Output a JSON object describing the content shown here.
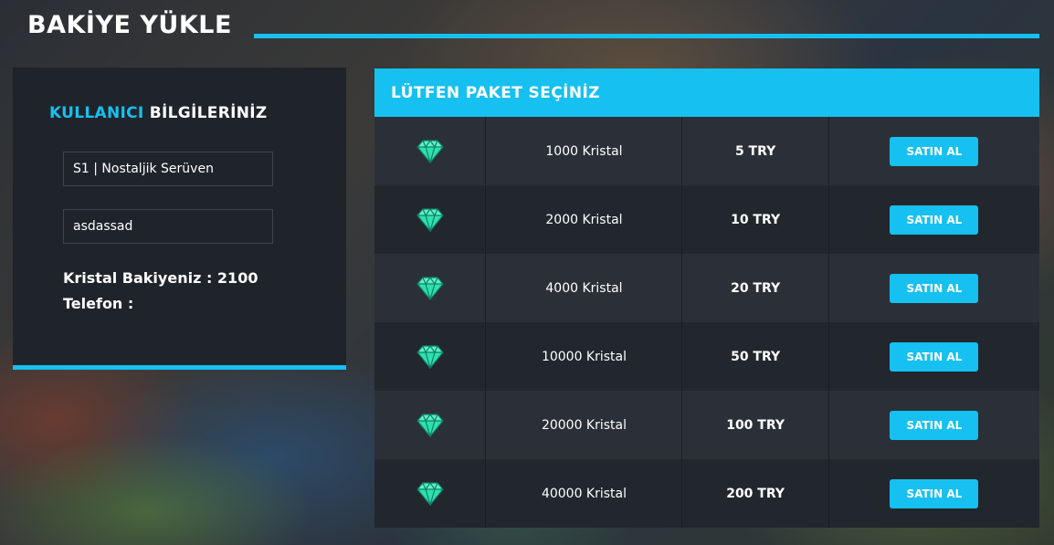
{
  "page": {
    "title": "BAKİYE YÜKLE"
  },
  "user_panel": {
    "heading_accent": "KULLANICI",
    "heading_rest": "BİLGİLERİNİZ",
    "server_value": "S1 | Nostaljik Serüven",
    "username_value": "asdassad",
    "balance_line": "Kristal Bakiyeniz : 2100",
    "phone_line": "Telefon :"
  },
  "packages": {
    "heading": "LÜTFEN PAKET SEÇİNİZ",
    "buy_label": "SATIN AL",
    "icon": "diamond-icon",
    "rows": [
      {
        "name": "1000 Kristal",
        "price": "5 TRY"
      },
      {
        "name": "2000 Kristal",
        "price": "10 TRY"
      },
      {
        "name": "4000 Kristal",
        "price": "20 TRY"
      },
      {
        "name": "10000 Kristal",
        "price": "50 TRY"
      },
      {
        "name": "20000 Kristal",
        "price": "100 TRY"
      },
      {
        "name": "40000 Kristal",
        "price": "200 TRY"
      }
    ]
  },
  "colors": {
    "accent": "#16c0f0",
    "panel": "#1f242b",
    "gem": "#2ee0b0"
  }
}
